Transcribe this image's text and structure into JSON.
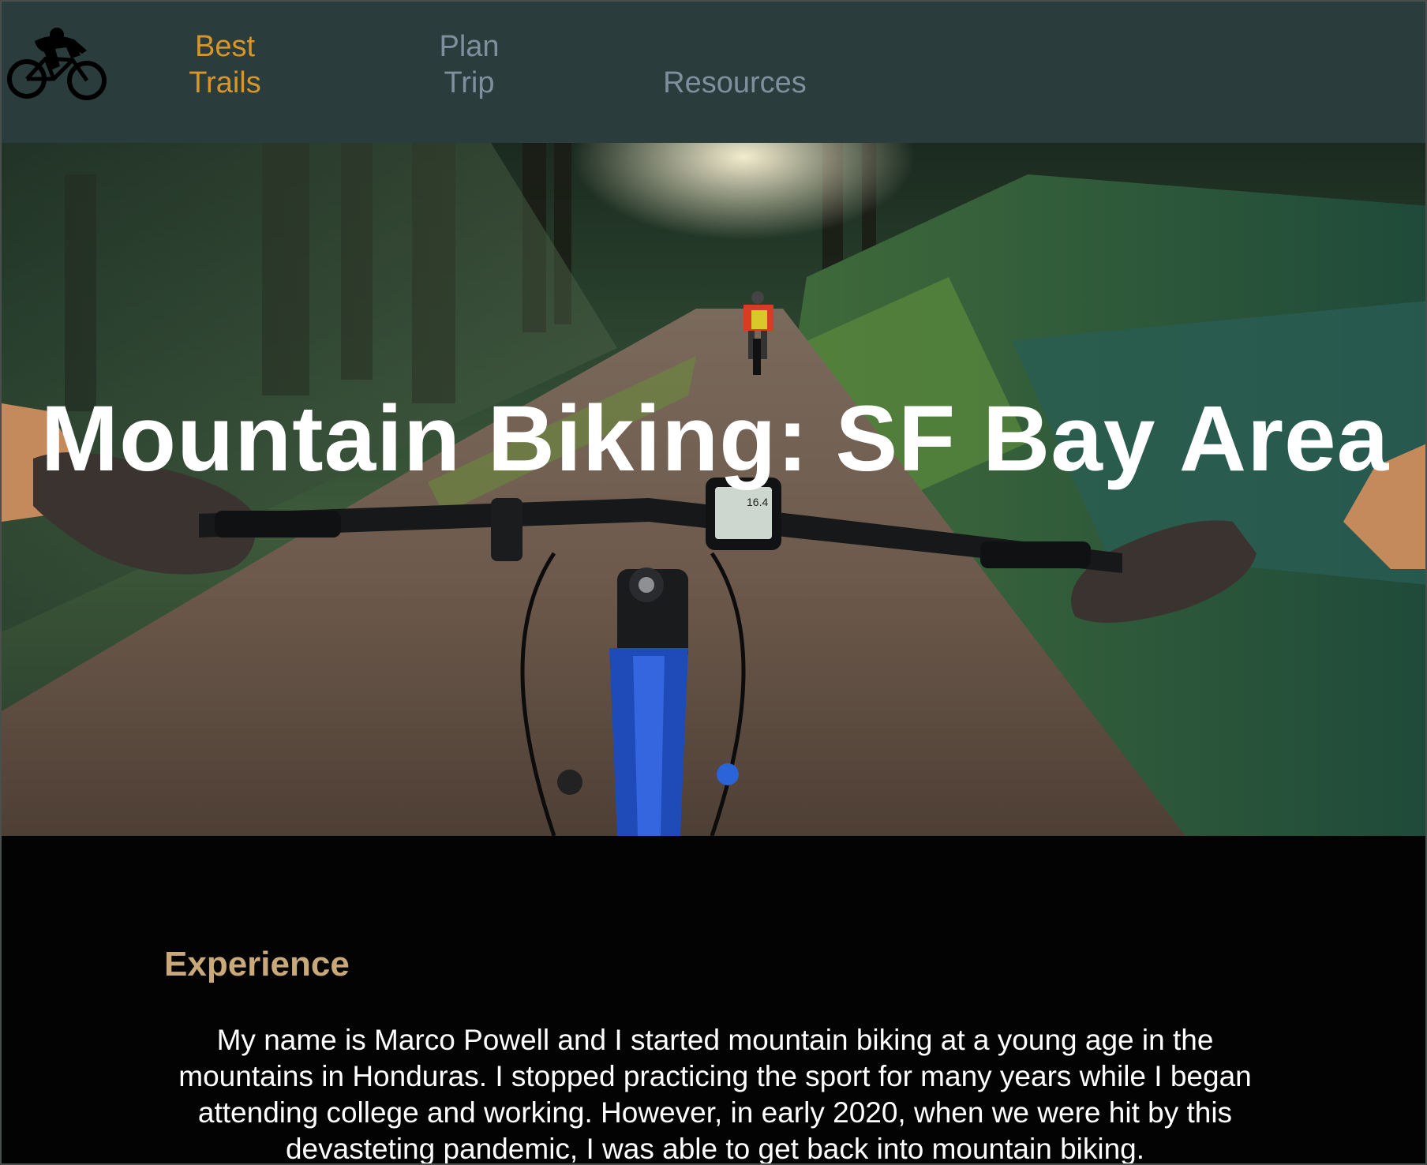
{
  "nav": {
    "logo_icon": "mountain-biker-icon",
    "links": [
      {
        "line1": "Best",
        "line2": "Trails",
        "color": "#d8962a",
        "active": true
      },
      {
        "line1": "Plan",
        "line2": "Trip",
        "color": "#7f8f9d",
        "active": false
      },
      {
        "line1": "Resources",
        "color": "#7f8f9d",
        "active": false
      }
    ],
    "background": "#2b3c3c"
  },
  "hero": {
    "title": "Mountain Biking: SF Bay Area",
    "image": "first-person view from bike handlebars on a forest trail with a rider ahead",
    "computer_readout": "16.4"
  },
  "experience": {
    "heading": "Experience",
    "heading_color": "#c9a97a",
    "body": "My name is Marco Powell and I started mountain biking at a young age in the mountains in Honduras. I stopped practicing the sport for many years while I began attending college and working. However, in early 2020, when we were hit by this devasteting pandemic, I was able to get back into mountain biking."
  }
}
